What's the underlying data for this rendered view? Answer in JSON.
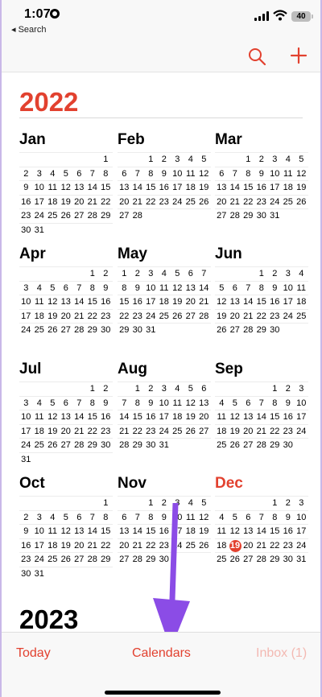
{
  "status_bar": {
    "time": "1:07",
    "back_label": "◂ Search",
    "battery": "40"
  },
  "navbar": {
    "search_icon": "magnifying-glass-icon",
    "add_icon": "plus-icon"
  },
  "year": "2022",
  "next_year": "2023",
  "today": {
    "month_index": 11,
    "day": "19"
  },
  "months": [
    {
      "name": "Jan",
      "start": 6,
      "days": 31
    },
    {
      "name": "Feb",
      "start": 2,
      "days": 28
    },
    {
      "name": "Mar",
      "start": 2,
      "days": 31
    },
    {
      "name": "Apr",
      "start": 5,
      "days": 30
    },
    {
      "name": "May",
      "start": 0,
      "days": 31
    },
    {
      "name": "Jun",
      "start": 3,
      "days": 30
    },
    {
      "name": "Jul",
      "start": 5,
      "days": 31
    },
    {
      "name": "Aug",
      "start": 1,
      "days": 31
    },
    {
      "name": "Sep",
      "start": 4,
      "days": 30
    },
    {
      "name": "Oct",
      "start": 6,
      "days": 31
    },
    {
      "name": "Nov",
      "start": 2,
      "days": 30
    },
    {
      "name": "Dec",
      "start": 4,
      "days": 31
    }
  ],
  "tabbar": {
    "today": "Today",
    "calendars": "Calendars",
    "inbox": "Inbox (1)"
  },
  "colors": {
    "accent": "#e2412f",
    "arrow": "#8b4ce6",
    "inbox_disabled": "#f3b9b2"
  }
}
